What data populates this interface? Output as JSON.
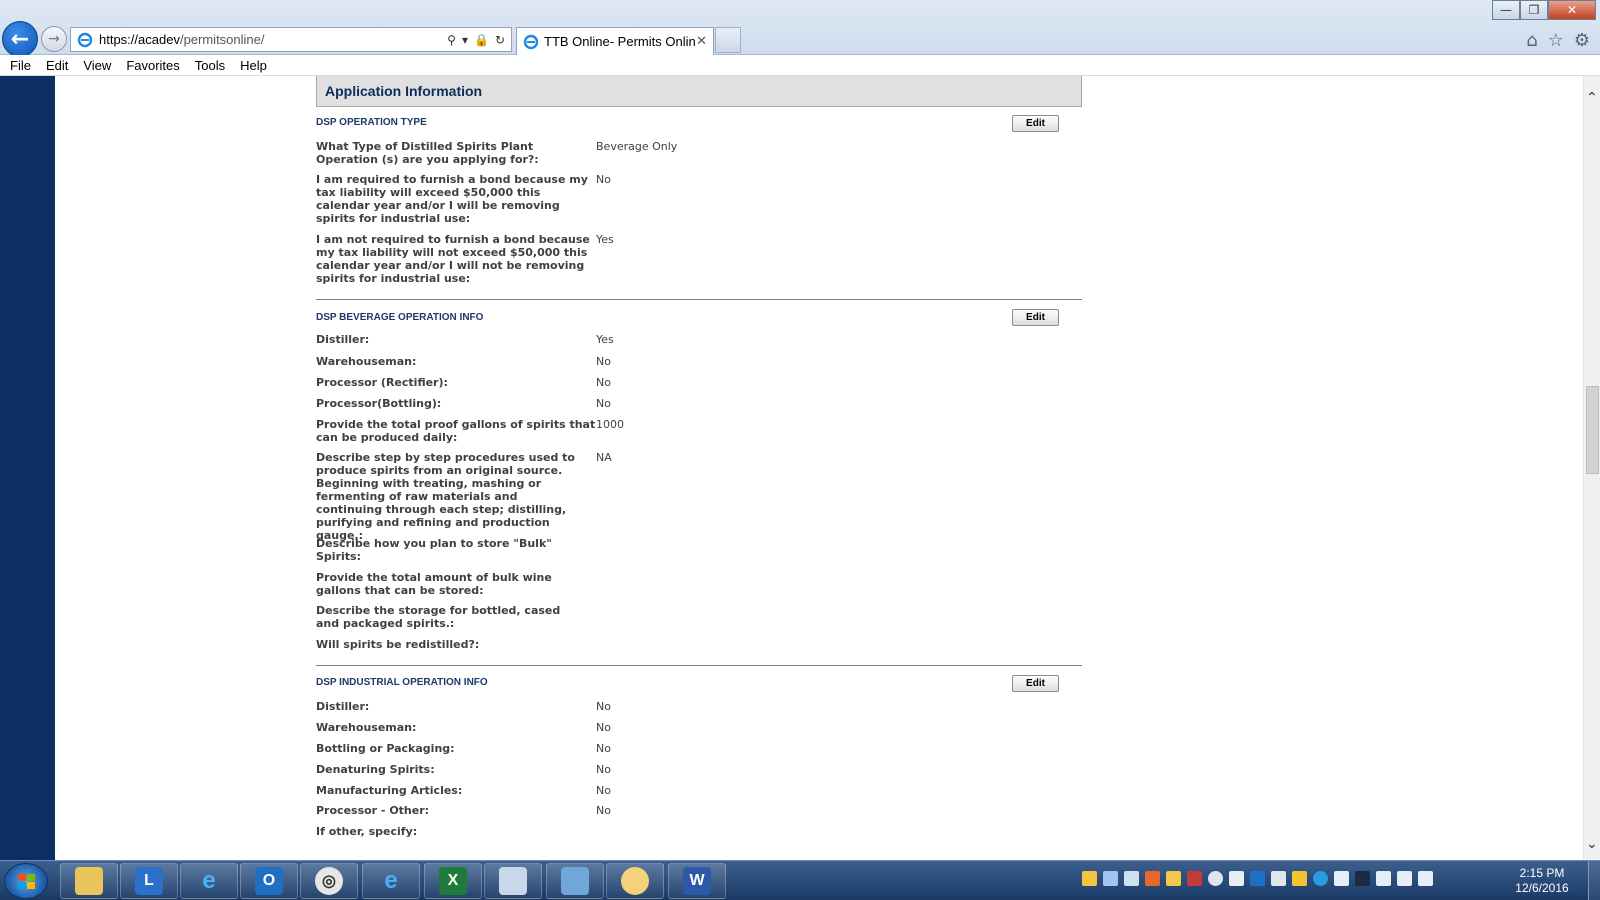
{
  "browser": {
    "url_host": "https://acadev",
    "url_path": "/permitsonline/",
    "tab_title": "TTB Online- Permits Online...",
    "menu": [
      "File",
      "Edit",
      "View",
      "Favorites",
      "Tools",
      "Help"
    ]
  },
  "app": {
    "header_title": "Application Information",
    "edit_label": "Edit",
    "sections": [
      {
        "title": "DSP OPERATION TYPE",
        "rows": [
          {
            "q": "What Type of Distilled Spirits Plant Operation (s) are you applying for?:",
            "a": "Beverage Only"
          },
          {
            "q": "I am required to furnish a bond because my tax liability will exceed $50,000 this calendar year and/or I will be removing spirits for industrial use:",
            "a": "No"
          },
          {
            "q": "I am not required to furnish a bond because my tax liability will not exceed $50,000 this calendar year and/or I will not be removing spirits for industrial use:",
            "a": "Yes"
          }
        ]
      },
      {
        "title": "DSP BEVERAGE OPERATION INFO",
        "rows": [
          {
            "q": "Distiller:",
            "a": "Yes"
          },
          {
            "q": "Warehouseman:",
            "a": "No"
          },
          {
            "q": "Processor (Rectifier):",
            "a": "No"
          },
          {
            "q": "Processor(Bottling):",
            "a": "No"
          },
          {
            "q": "Provide the total proof gallons of spirits that can be produced daily:",
            "a": "1000"
          },
          {
            "q": "Describe step by step procedures used to produce spirits from an original source. Beginning with treating, mashing or fermenting of raw materials and continuing through each step; distilling, purifying and refining and production gauge.:",
            "a": "NA"
          },
          {
            "q": "Describe how you plan to store \"Bulk\" Spirits:",
            "a": ""
          },
          {
            "q": "Provide the total amount of bulk wine gallons that can be stored:",
            "a": ""
          },
          {
            "q": "Describe the storage for bottled, cased and packaged spirits.:",
            "a": ""
          },
          {
            "q": "Will spirits be redistilled?:",
            "a": ""
          }
        ]
      },
      {
        "title": "DSP INDUSTRIAL OPERATION INFO",
        "rows": [
          {
            "q": "Distiller:",
            "a": "No"
          },
          {
            "q": "Warehouseman:",
            "a": "No"
          },
          {
            "q": "Bottling or Packaging:",
            "a": "No"
          },
          {
            "q": "Denaturing Spirits:",
            "a": "No"
          },
          {
            "q": "Manufacturing Articles:",
            "a": "No"
          },
          {
            "q": "Processor - Other:",
            "a": "No"
          },
          {
            "q": "If other, specify:",
            "a": ""
          }
        ]
      }
    ]
  },
  "taskbar": {
    "time": "2:15 PM",
    "date": "12/6/2016",
    "apps": [
      "file-explorer",
      "lync",
      "internet-explorer",
      "outlook",
      "app-spiral",
      "internet-explorer-2",
      "excel",
      "notepad",
      "photo-viewer",
      "paint",
      "word"
    ]
  }
}
